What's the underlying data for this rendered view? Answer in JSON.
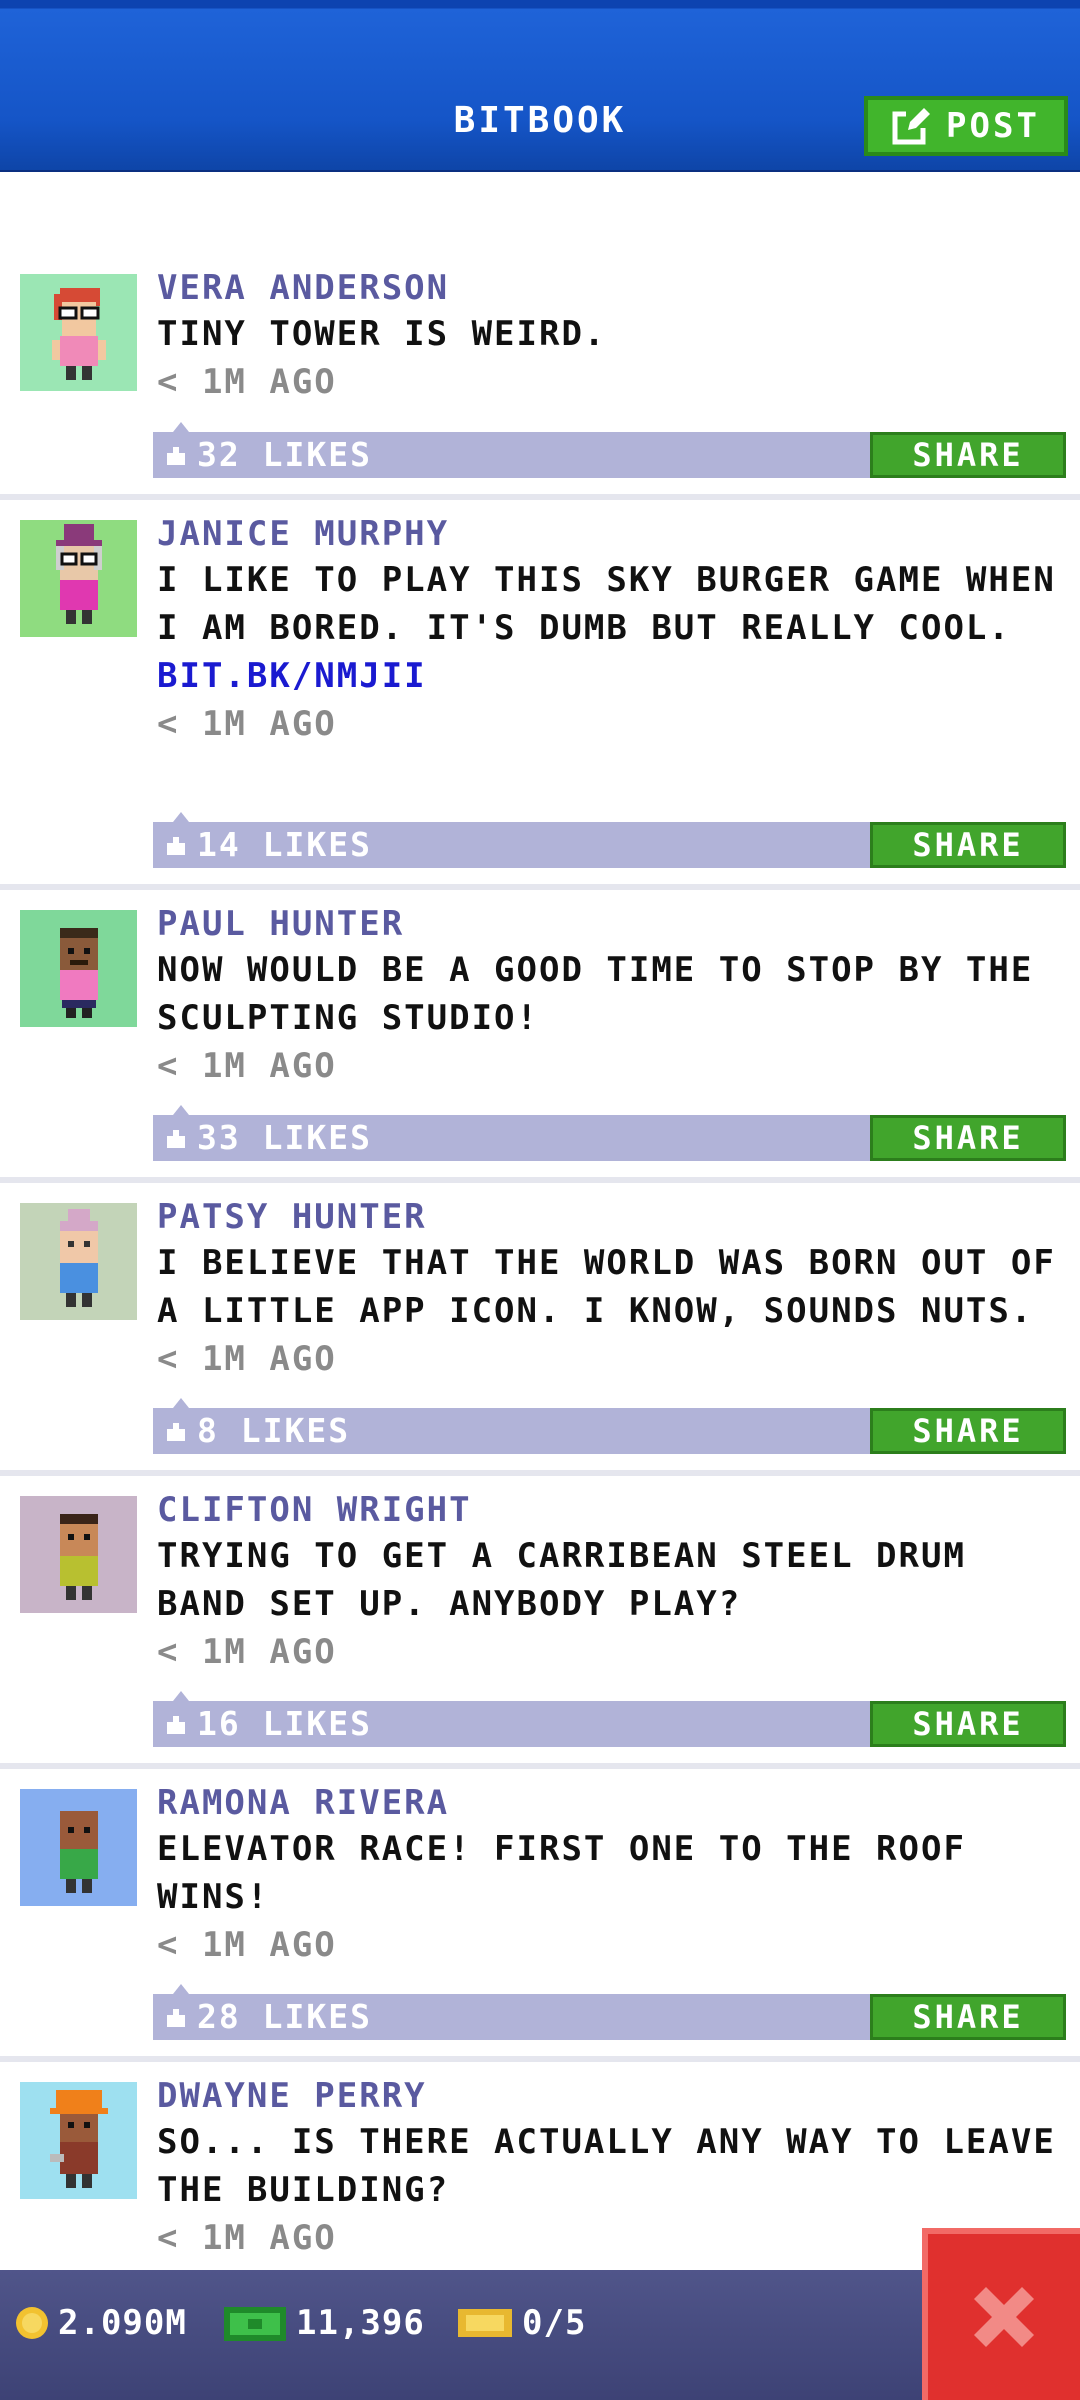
{
  "header": {
    "title": "BITBOOK",
    "post_label": "POST"
  },
  "posts": [
    {
      "name": "VERA ANDERSON",
      "message": "TINY TOWER IS WEIRD.",
      "link": "",
      "time": "< 1M AGO",
      "likes": "32 LIKES",
      "share": "SHARE",
      "avatar_bg": "#9be6b4"
    },
    {
      "name": "JANICE MURPHY",
      "message": "I LIKE TO PLAY THIS SKY BURGER GAME WHEN I AM BORED. IT'S DUMB BUT REALLY COOL.",
      "link": "BIT.BK/NMJII",
      "time": "< 1M AGO",
      "likes": "14 LIKES",
      "share": "SHARE",
      "avatar_bg": "#8fdc80"
    },
    {
      "name": "PAUL HUNTER",
      "message": "NOW WOULD BE A GOOD TIME TO STOP BY THE SCULPTING STUDIO!",
      "link": "",
      "time": "< 1M AGO",
      "likes": "33 LIKES",
      "share": "SHARE",
      "avatar_bg": "#7fd89a"
    },
    {
      "name": "PATSY HUNTER",
      "message": "I BELIEVE THAT THE WORLD WAS BORN OUT OF A LITTLE APP ICON. I KNOW, SOUNDS NUTS.",
      "link": "",
      "time": "< 1M AGO",
      "likes": "8 LIKES",
      "share": "SHARE",
      "avatar_bg": "#c3d4b8"
    },
    {
      "name": "CLIFTON WRIGHT",
      "message": "TRYING TO GET A CARRIBEAN STEEL DRUM BAND SET UP. ANYBODY PLAY?",
      "link": "",
      "time": "< 1M AGO",
      "likes": "16 LIKES",
      "share": "SHARE",
      "avatar_bg": "#c8b4c8"
    },
    {
      "name": "RAMONA RIVERA",
      "message": "ELEVATOR RACE! FIRST ONE TO THE ROOF WINS!",
      "link": "",
      "time": "< 1M AGO",
      "likes": "28 LIKES",
      "share": "SHARE",
      "avatar_bg": "#86aef0"
    },
    {
      "name": "DWAYNE PERRY",
      "message": "SO... IS THERE ACTUALLY ANY WAY TO LEAVE THE BUILDING?",
      "link": "",
      "time": "< 1M AGO",
      "likes": "",
      "share": "",
      "avatar_bg": "#9ee0f0"
    }
  ],
  "bottom": {
    "coins": "2.090M",
    "bux": "11,396",
    "tickets": "0/5"
  },
  "colors": {
    "header_blue": "#1555c7",
    "accent_green": "#41b52c",
    "like_bar": "#b1b3d8",
    "close_red": "#e0302e"
  }
}
